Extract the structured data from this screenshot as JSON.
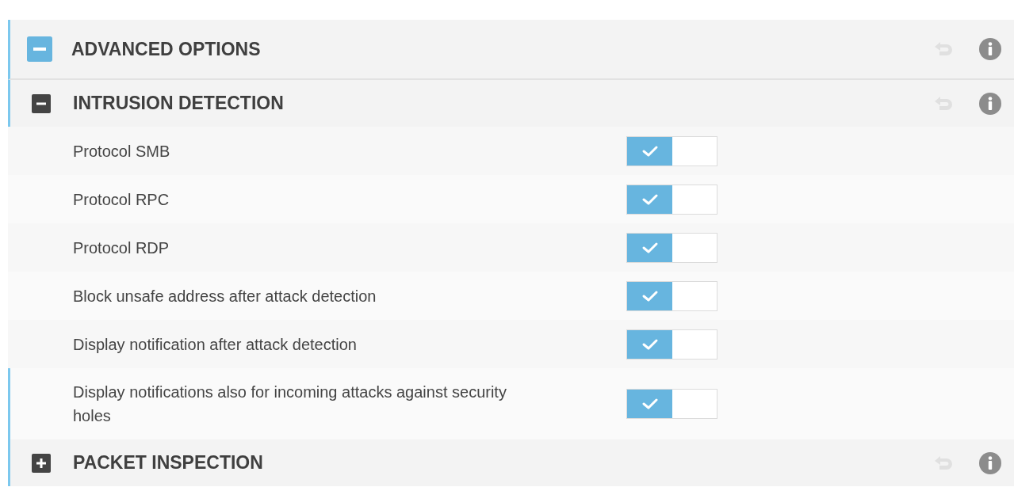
{
  "section": {
    "title": "ADVANCED OPTIONS",
    "expanded": true,
    "subsections": [
      {
        "title": "INTRUSION DETECTION",
        "expanded": true,
        "settings": [
          {
            "label": "Protocol SMB",
            "on": true,
            "highlighted": false
          },
          {
            "label": "Protocol RPC",
            "on": true,
            "highlighted": false
          },
          {
            "label": "Protocol RDP",
            "on": true,
            "highlighted": false
          },
          {
            "label": "Block unsafe address after attack detection",
            "on": true,
            "highlighted": false
          },
          {
            "label": "Display notification after attack detection",
            "on": true,
            "highlighted": false
          },
          {
            "label": "Display notifications also for incoming attacks against security holes",
            "on": true,
            "highlighted": true
          }
        ]
      },
      {
        "title": "PACKET INSPECTION",
        "expanded": false
      }
    ]
  }
}
